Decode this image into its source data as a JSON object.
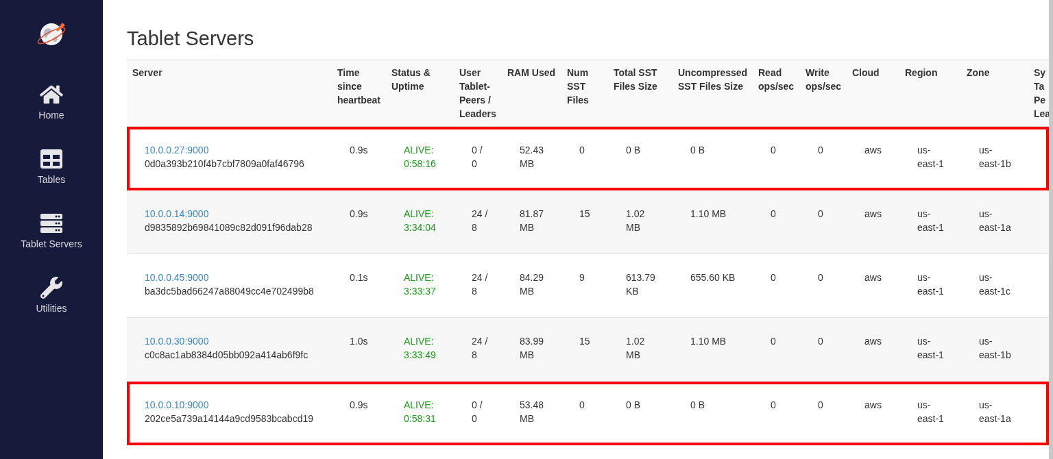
{
  "sidebar": {
    "items": [
      {
        "kind": "home",
        "label": "Home"
      },
      {
        "kind": "tables",
        "label": "Tables"
      },
      {
        "kind": "servers",
        "label": "Tablet Servers"
      },
      {
        "kind": "utilities",
        "label": "Utilities"
      }
    ]
  },
  "page_title": "Tablet Servers",
  "table": {
    "columns": [
      "Server",
      "Time since heartbeat",
      "Status & Uptime",
      "User Tablet-Peers / Leaders",
      "RAM Used",
      "Num SST Files",
      "Total SST Files Size",
      "Uncompressed SST Files Size",
      "Read ops/sec",
      "Write ops/sec",
      "Cloud",
      "Region",
      "Zone",
      "Sy Ta Pe Lea"
    ],
    "rows": [
      {
        "highlighted": true,
        "address": "10.0.0.27:9000",
        "uuid": "0d0a393b210f4b7cbf7809a0faf46796",
        "heartbeat": "0.9s",
        "status": "ALIVE: 0:58:16",
        "peers": "0 / 0",
        "ram": "52.43 MB",
        "num_sst": "0",
        "total_sst": "0 B",
        "uncompressed_sst": "0 B",
        "read_ops": "0",
        "write_ops": "0",
        "cloud": "aws",
        "region": "us-east-1",
        "zone": "us-east-1b"
      },
      {
        "highlighted": false,
        "address": "10.0.0.14:9000",
        "uuid": "d9835892b69841089c82d091f96dab28",
        "heartbeat": "0.9s",
        "status": "ALIVE: 3:34:04",
        "peers": "24 / 8",
        "ram": "81.87 MB",
        "num_sst": "15",
        "total_sst": "1.02 MB",
        "uncompressed_sst": "1.10 MB",
        "read_ops": "0",
        "write_ops": "0",
        "cloud": "aws",
        "region": "us-east-1",
        "zone": "us-east-1a"
      },
      {
        "highlighted": false,
        "address": "10.0.0.45:9000",
        "uuid": "ba3dc5bad66247a88049cc4e702499b8",
        "heartbeat": "0.1s",
        "status": "ALIVE: 3:33:37",
        "peers": "24 / 8",
        "ram": "84.29 MB",
        "num_sst": "9",
        "total_sst": "613.79 KB",
        "uncompressed_sst": "655.60 KB",
        "read_ops": "0",
        "write_ops": "0",
        "cloud": "aws",
        "region": "us-east-1",
        "zone": "us-east-1c"
      },
      {
        "highlighted": false,
        "address": "10.0.0.30:9000",
        "uuid": "c0c8ac1ab8384d05bb092a414ab6f9fc",
        "heartbeat": "1.0s",
        "status": "ALIVE: 3:33:49",
        "peers": "24 / 8",
        "ram": "83.99 MB",
        "num_sst": "15",
        "total_sst": "1.02 MB",
        "uncompressed_sst": "1.10 MB",
        "read_ops": "0",
        "write_ops": "0",
        "cloud": "aws",
        "region": "us-east-1",
        "zone": "us-east-1b"
      },
      {
        "highlighted": true,
        "address": "10.0.0.10:9000",
        "uuid": "202ce5a739a14144a9cd9583bcabcd19",
        "heartbeat": "0.9s",
        "status": "ALIVE: 0:58:31",
        "peers": "0 / 0",
        "ram": "53.48 MB",
        "num_sst": "0",
        "total_sst": "0 B",
        "uncompressed_sst": "0 B",
        "read_ops": "0",
        "write_ops": "0",
        "cloud": "aws",
        "region": "us-east-1",
        "zone": "us-east-1a"
      }
    ]
  }
}
